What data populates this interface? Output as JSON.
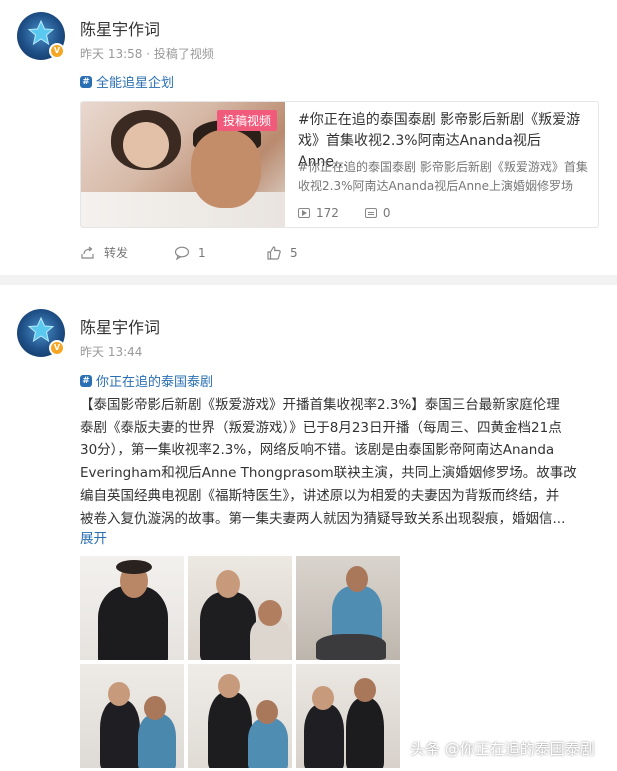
{
  "post1": {
    "username": "陈星宇作词",
    "time": "昨天 13:58",
    "action": "· 投稿了视频",
    "topic": "全能追星企划",
    "video": {
      "tag": "投稿视频",
      "title_line1": "#你正在追的泰国泰剧 影帝影后新剧《叛爱游",
      "title_line2": "戏》首集收视2.3%阿南达Ananda视后Anne...",
      "desc_line1": "#你正在追的泰国泰剧 影帝影后新剧《叛爱游戏》首集",
      "desc_line2": "收视2.3%阿南达Ananda视后Anne上演婚姻修罗场",
      "plays": "172",
      "comments": "0"
    },
    "actions": {
      "repost": "转发",
      "comment": "1",
      "like": "5"
    }
  },
  "post2": {
    "username": "陈星宇作词",
    "time": "昨天 13:44",
    "topic": "你正在追的泰国泰剧",
    "text_lines": [
      "【泰国影帝影后新剧《叛爱游戏》开播首集收视率2.3%】泰国三台最新家庭伦理",
      "泰剧《泰版夫妻的世界（叛爱游戏）》已于8月23日开播（每周三、四黄金档21点",
      "30分），第一集收视率2.3%，网络反响不错。该剧是由泰国影帝阿南达Ananda",
      "Everingham和视后Anne Thongprasom联袂主演，共同上演婚姻修罗场。故事改",
      "编自英国经典电视剧《福斯特医生》，讲述原以为相爱的夫妻因为背叛而终结，并",
      "被卷入复仇漩涡的故事。第一集夫妻两人就因为猜疑导致关系出现裂痕，婚姻信..."
    ],
    "expand": "展开"
  },
  "watermark": "头条 @你正在追的泰国泰剧",
  "colors": {
    "link": "#2a6fb3",
    "tag": "#f25a7c",
    "badge": "#f5a623"
  }
}
